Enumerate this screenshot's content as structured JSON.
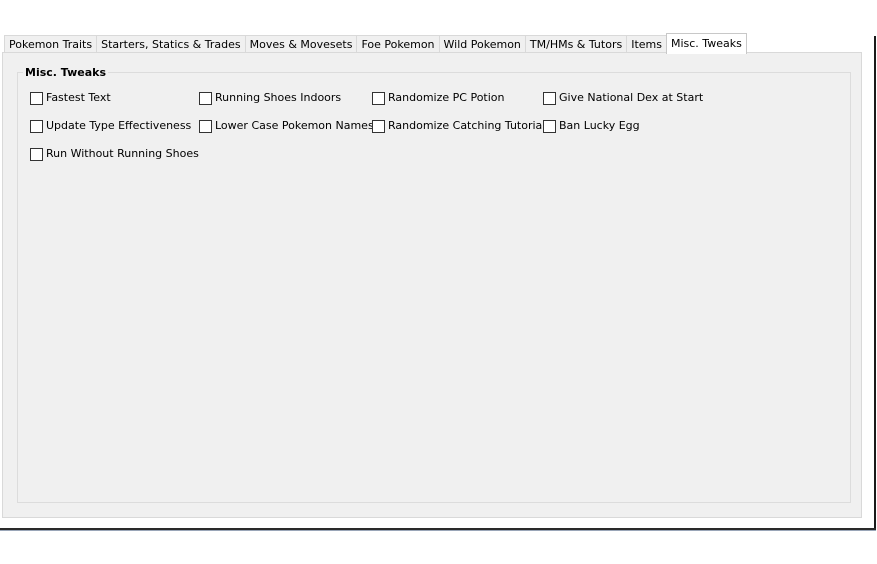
{
  "tabs": [
    {
      "label": "Pokemon Traits",
      "active": false
    },
    {
      "label": "Starters, Statics & Trades",
      "active": false
    },
    {
      "label": "Moves & Movesets",
      "active": false
    },
    {
      "label": "Foe Pokemon",
      "active": false
    },
    {
      "label": "Wild Pokemon",
      "active": false
    },
    {
      "label": "TM/HMs & Tutors",
      "active": false
    },
    {
      "label": "Items",
      "active": false
    },
    {
      "label": "Misc. Tweaks",
      "active": true
    }
  ],
  "group": {
    "title": "Misc. Tweaks",
    "options": [
      {
        "label": "Fastest Text",
        "checked": false
      },
      {
        "label": "Running Shoes Indoors",
        "checked": false
      },
      {
        "label": "Randomize PC Potion",
        "checked": false
      },
      {
        "label": "Give National Dex at Start",
        "checked": false
      },
      {
        "label": "Update Type Effectiveness",
        "checked": false
      },
      {
        "label": "Lower Case Pokemon Names",
        "checked": false
      },
      {
        "label": "Randomize Catching Tutorial",
        "checked": false
      },
      {
        "label": "Ban Lucky Egg",
        "checked": false
      },
      {
        "label": "Run Without Running Shoes",
        "checked": false
      }
    ]
  }
}
